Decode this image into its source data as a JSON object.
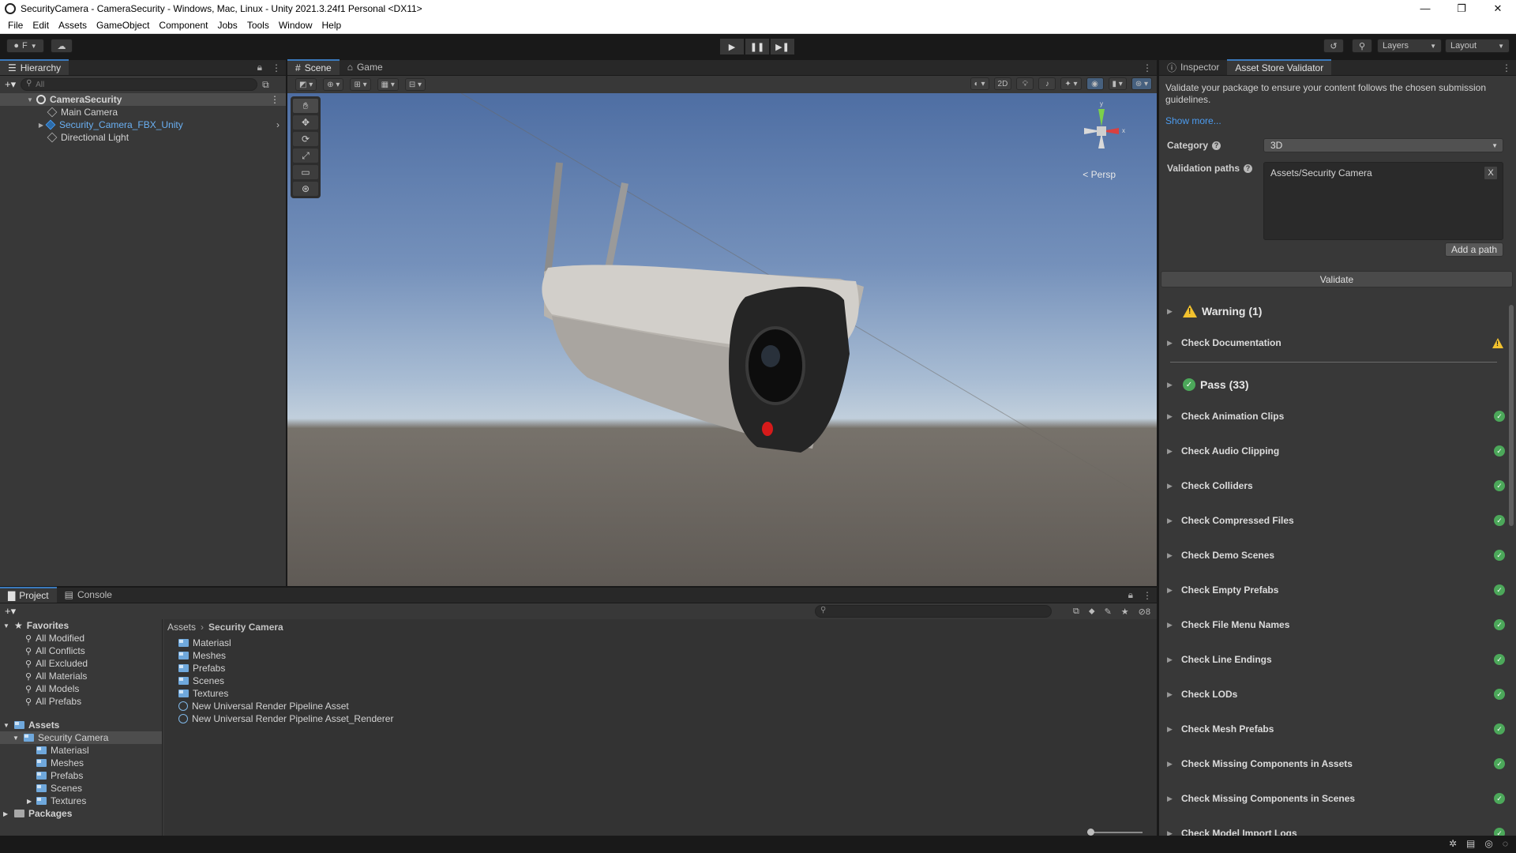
{
  "window": {
    "title": "SecurityCamera - CameraSecurity - Windows, Mac, Linux - Unity 2021.3.24f1 Personal <DX11>",
    "controls": [
      "—",
      "❐",
      "✕"
    ]
  },
  "menu": [
    "File",
    "Edit",
    "Assets",
    "GameObject",
    "Component",
    "Jobs",
    "Tools",
    "Window",
    "Help"
  ],
  "toolbar": {
    "account": "F",
    "play": "▶",
    "pause": "❚❚",
    "step": "▶❚",
    "layers": "Layers",
    "layout": "Layout"
  },
  "hierarchy": {
    "tab": "Hierarchy",
    "search_placeholder": "All",
    "scene": "CameraSecurity",
    "items": [
      "Main Camera",
      "Security_Camera_FBX_Unity",
      "Directional Light"
    ]
  },
  "scene": {
    "tabs": [
      "Scene",
      "Game"
    ],
    "mode_2d": "2D",
    "persp": "< Persp",
    "gizmo_axes": [
      "y",
      "x"
    ]
  },
  "inspector": {
    "tabs": [
      "Inspector",
      "Asset Store Validator"
    ],
    "description": "Validate your package to ensure your content follows the chosen submission guidelines.",
    "show_more": "Show more...",
    "category_label": "Category",
    "category_value": "3D",
    "paths_label": "Validation paths",
    "path_value": "Assets/Security Camera",
    "remove_path": "X",
    "add_path": "Add a path",
    "validate": "Validate",
    "warning_header": "Warning (1)",
    "warnings": [
      "Check Documentation"
    ],
    "pass_header": "Pass (33)",
    "passes": [
      "Check Animation Clips",
      "Check Audio Clipping",
      "Check Colliders",
      "Check Compressed Files",
      "Check Demo Scenes",
      "Check Empty Prefabs",
      "Check File Menu Names",
      "Check Line Endings",
      "Check LODs",
      "Check Mesh Prefabs",
      "Check Missing Components in Assets",
      "Check Missing Components in Scenes",
      "Check Model Import Logs"
    ]
  },
  "project": {
    "tabs": [
      "Project",
      "Console"
    ],
    "favorites_label": "Favorites",
    "favorites": [
      "All Modified",
      "All Conflicts",
      "All Excluded",
      "All Materials",
      "All Models",
      "All Prefabs"
    ],
    "assets_label": "Assets",
    "security_camera": "Security Camera",
    "subfolders": [
      "Materiasl",
      "Meshes",
      "Prefabs",
      "Scenes",
      "Textures"
    ],
    "packages_label": "Packages",
    "breadcrumb": [
      "Assets",
      "Security Camera"
    ],
    "contents_folders": [
      "Materiasl",
      "Meshes",
      "Prefabs",
      "Scenes",
      "Textures"
    ],
    "contents_assets": [
      "New Universal Render Pipeline Asset",
      "New Universal Render Pipeline Asset_Renderer"
    ],
    "hidden_count": "8"
  },
  "colors": {
    "accent": "#3a79bb",
    "pass_green": "#4ca85a",
    "warning_yellow": "#f2c12e",
    "link_blue": "#4c9cf0"
  }
}
